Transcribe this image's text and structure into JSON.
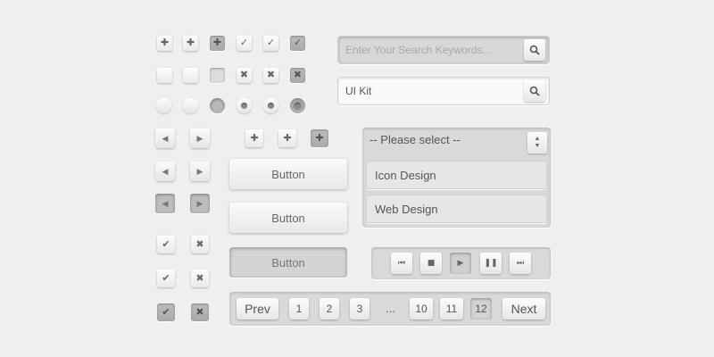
{
  "search_disabled": {
    "placeholder": "Enter Your Search Keywords..."
  },
  "search_active": {
    "value": "UI Kit"
  },
  "buttons": {
    "normal_1": "Button",
    "normal_2": "Button",
    "pressed": "Button"
  },
  "select": {
    "placeholder": "-- Please select --",
    "options": [
      "Icon Design",
      "Web Design"
    ]
  },
  "media_controls": [
    "skip-back",
    "stop",
    "play",
    "pause",
    "skip-forward"
  ],
  "pagination": {
    "prev": "Prev",
    "pages": [
      "1",
      "2",
      "3",
      "10",
      "11",
      "12"
    ],
    "ellipsis": "...",
    "next": "Next",
    "current": "12"
  }
}
